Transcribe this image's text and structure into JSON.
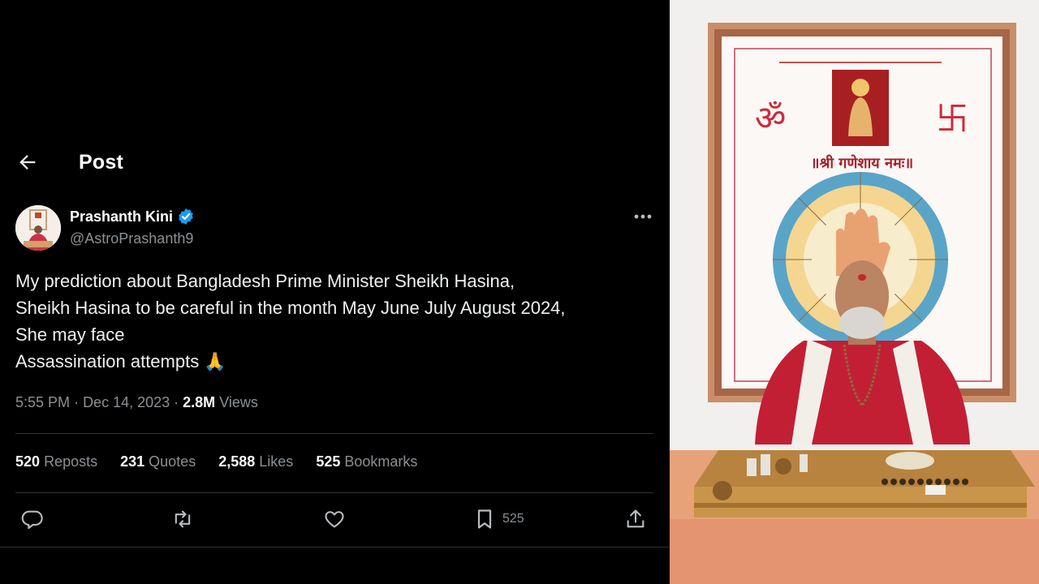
{
  "header": {
    "title": "Post"
  },
  "author": {
    "name": "Prashanth Kini",
    "handle": "@AstroPrashanth9"
  },
  "tweet": {
    "lines": [
      "My prediction about Bangladesh Prime Minister Sheikh Hasina,",
      "Sheikh Hasina to be careful in the month May June July August 2024,",
      "She may face",
      "Assassination attempts 🙏"
    ],
    "time": "5:55 PM",
    "date": "Dec 14, 2023",
    "views_count": "2.8M",
    "views_label": "Views"
  },
  "stats": {
    "reposts": {
      "count": "520",
      "label": "Reposts"
    },
    "quotes": {
      "count": "231",
      "label": "Quotes"
    },
    "likes": {
      "count": "2,588",
      "label": "Likes"
    },
    "bookmarks": {
      "count": "525",
      "label": "Bookmarks"
    }
  },
  "actions": {
    "bookmark_count": "525"
  },
  "photo": {
    "banner_text": "॥श्री गणेशाय नमः॥",
    "om_symbol": "ॐ",
    "swastika_symbol": "卐"
  },
  "colors": {
    "background": "#000000",
    "text": "#e7e9ea",
    "secondary": "#71767b",
    "verified": "#1d9bf0",
    "divider": "#2f3336"
  }
}
